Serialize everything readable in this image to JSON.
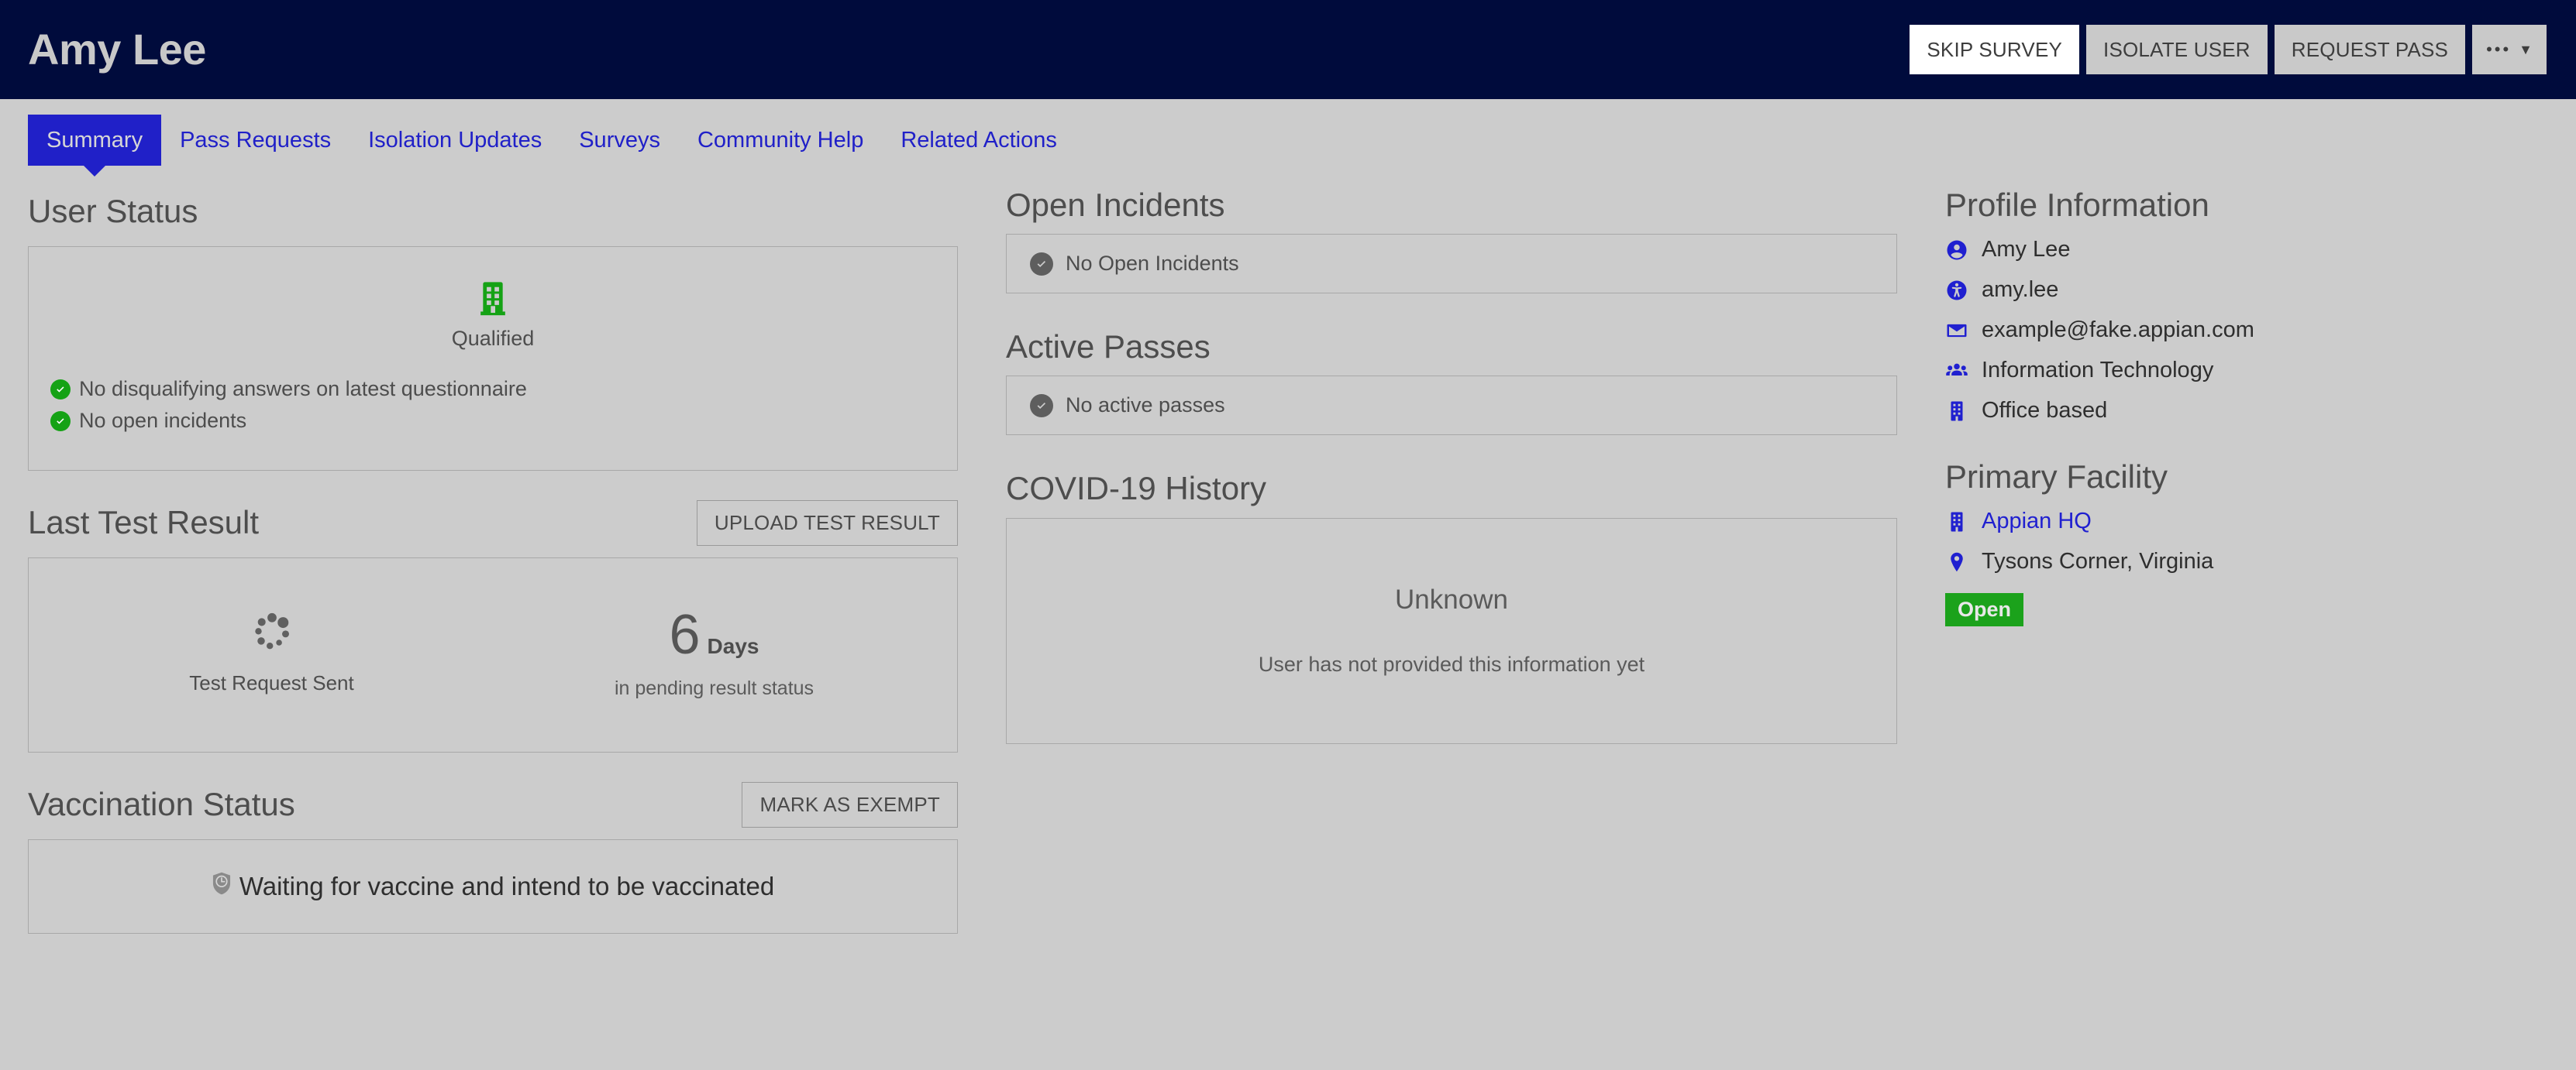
{
  "header": {
    "title": "Amy Lee",
    "buttons": [
      {
        "label": "SKIP SURVEY",
        "style": "primary"
      },
      {
        "label": "ISOLATE USER",
        "style": "default"
      },
      {
        "label": "REQUEST PASS",
        "style": "default"
      },
      {
        "label": "•••",
        "caret": "▼",
        "style": "more"
      }
    ],
    "bg_color": "#000b3c"
  },
  "tabs": [
    {
      "label": "Summary",
      "active": true
    },
    {
      "label": "Pass Requests",
      "active": false
    },
    {
      "label": "Isolation Updates",
      "active": false
    },
    {
      "label": "Surveys",
      "active": false
    },
    {
      "label": "Community Help",
      "active": false
    },
    {
      "label": "Related Actions",
      "active": false
    }
  ],
  "tab_accent_color": "#2020c8",
  "left": {
    "user_status": {
      "title": "User Status",
      "hero_icon": "building-icon",
      "hero_icon_color": "#15a215",
      "hero_label": "Qualified",
      "checks": [
        "No disqualifying answers on latest questionnaire",
        "No open incidents"
      ]
    },
    "last_test": {
      "title": "Last Test Result",
      "button": "UPLOAD TEST RESULT",
      "left_icon": "spinner-icon",
      "left_label": "Test Request Sent",
      "days_value": "6",
      "days_unit": "Days",
      "days_sub": "in pending result status"
    },
    "vaccination": {
      "title": "Vaccination Status",
      "button": "MARK AS EXEMPT",
      "icon": "shield-clock-icon",
      "status": "Waiting for vaccine and intend to be vaccinated"
    }
  },
  "mid": {
    "open_incidents": {
      "title": "Open Incidents",
      "icon": "check-circle-icon",
      "message": "No Open Incidents"
    },
    "active_passes": {
      "title": "Active Passes",
      "icon": "check-circle-icon",
      "message": "No active passes"
    },
    "covid_history": {
      "title": "COVID-19 History",
      "main": "Unknown",
      "sub": "User has not provided this information yet"
    }
  },
  "right": {
    "profile": {
      "title": "Profile Information",
      "items": [
        {
          "icon": "user-circle-icon",
          "text": "Amy Lee"
        },
        {
          "icon": "accessibility-icon",
          "text": "amy.lee"
        },
        {
          "icon": "envelope-icon",
          "text": "example@fake.appian.com"
        },
        {
          "icon": "users-group-icon",
          "text": "Information Technology"
        },
        {
          "icon": "building-icon",
          "text": "Office based"
        }
      ]
    },
    "facility": {
      "title": "Primary Facility",
      "name": "Appian HQ",
      "name_icon": "building-icon",
      "location": "Tysons Corner, Virginia",
      "location_icon": "map-pin-icon",
      "badge": "Open",
      "badge_color": "#1ba21b"
    }
  }
}
